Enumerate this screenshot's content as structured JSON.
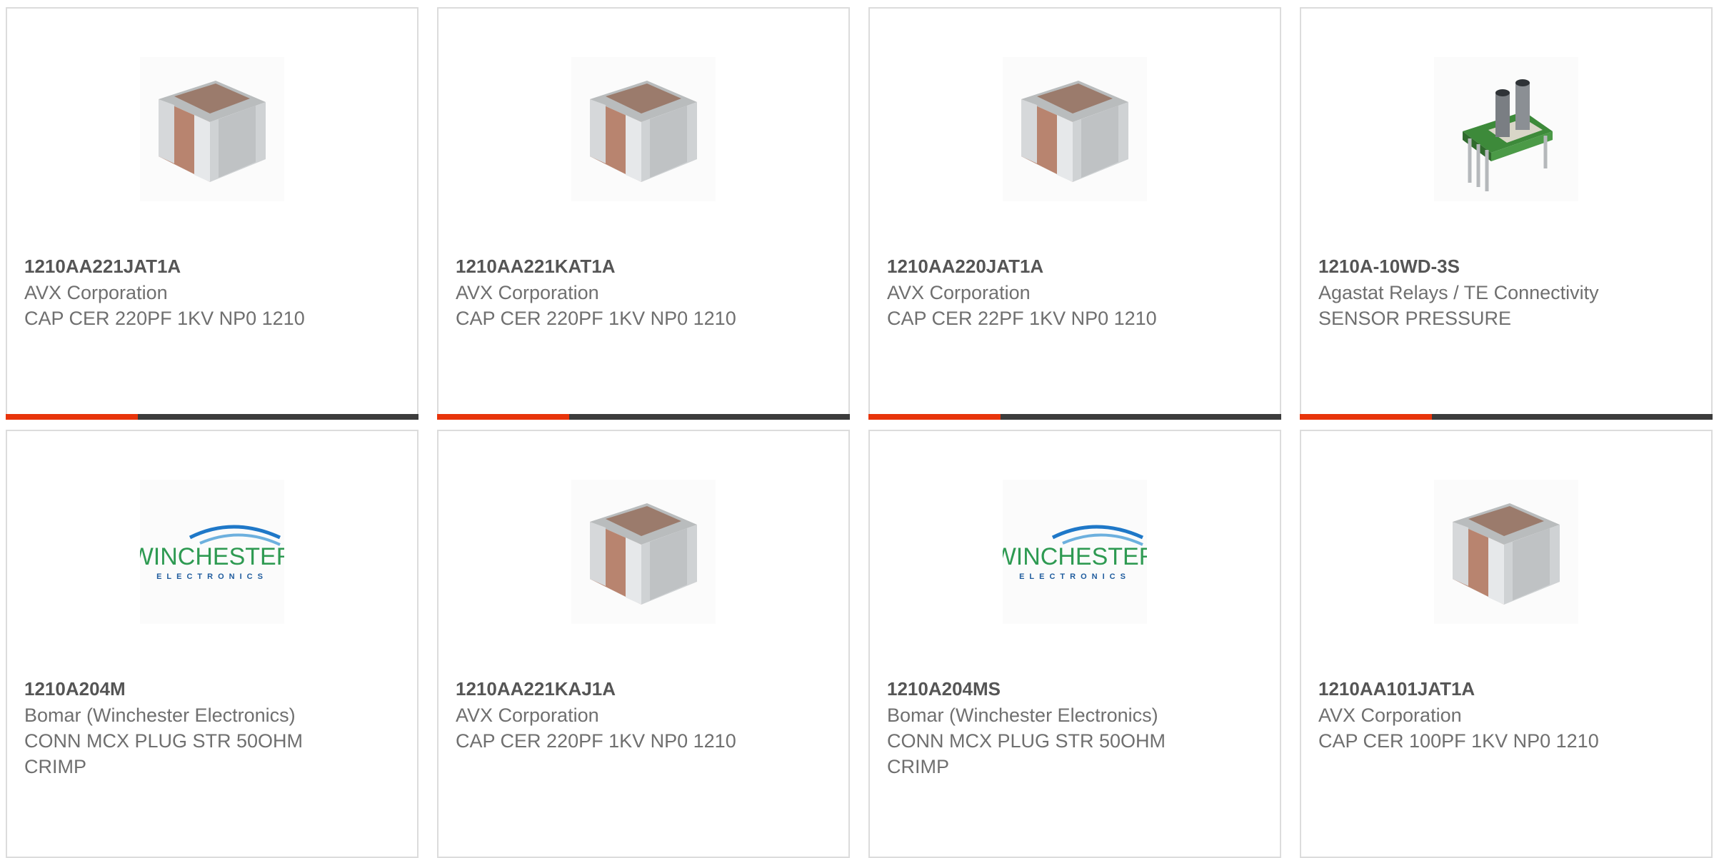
{
  "accent_color": "#e8340b",
  "bar_color": "#3c3c3c",
  "cards": [
    {
      "part": "1210AA221JAT1A",
      "manufacturer": "AVX Corporation",
      "description": "CAP CER 220PF 1KV NP0 1210",
      "image": "ceramic-capacitor-image",
      "progress": 0.32
    },
    {
      "part": "1210AA221KAT1A",
      "manufacturer": "AVX Corporation",
      "description": "CAP CER 220PF 1KV NP0 1210",
      "image": "ceramic-capacitor-image",
      "progress": 0.32
    },
    {
      "part": "1210AA220JAT1A",
      "manufacturer": "AVX Corporation",
      "description": "CAP CER 22PF 1KV NP0 1210",
      "image": "ceramic-capacitor-image",
      "progress": 0.32
    },
    {
      "part": "1210A-10WD-3S",
      "manufacturer": "Agastat Relays / TE Connectivity",
      "description": "SENSOR PRESSURE",
      "image": "pressure-sensor-image",
      "progress": 0.32
    },
    {
      "part": "1210A204M",
      "manufacturer": "Bomar (Winchester Electronics)",
      "description": "CONN MCX PLUG STR 50OHM CRIMP",
      "image": "winchester-logo",
      "logo_text": "WINCHESTER",
      "logo_subtext": "ELECTRONICS"
    },
    {
      "part": "1210AA221KAJ1A",
      "manufacturer": "AVX Corporation",
      "description": "CAP CER 220PF 1KV NP0 1210",
      "image": "ceramic-capacitor-image"
    },
    {
      "part": "1210A204MS",
      "manufacturer": "Bomar (Winchester Electronics)",
      "description": "CONN MCX PLUG STR 50OHM CRIMP",
      "image": "winchester-logo",
      "logo_text": "WINCHESTER",
      "logo_subtext": "ELECTRONICS"
    },
    {
      "part": "1210AA101JAT1A",
      "manufacturer": "AVX Corporation",
      "description": "CAP CER 100PF 1KV NP0 1210",
      "image": "ceramic-capacitor-image"
    }
  ]
}
